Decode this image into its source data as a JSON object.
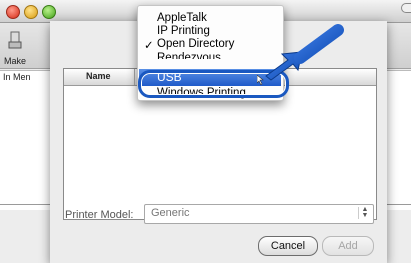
{
  "background_window": {
    "toolbar_item_label": "Make",
    "sidebar_label": "In Men"
  },
  "sheet": {
    "list_column_name": "Name",
    "printer_model_label": "Printer Model:",
    "printer_model_value": "Generic",
    "cancel_label": "Cancel",
    "add_label": "Add"
  },
  "popup_menu": {
    "items": [
      {
        "label": "AppleTalk",
        "checked": false
      },
      {
        "label": "IP Printing",
        "checked": false
      },
      {
        "label": "Open Directory",
        "checked": true
      },
      {
        "label": "Rendezvous",
        "checked": false
      },
      {
        "label": "USB",
        "checked": false,
        "highlighted": true
      },
      {
        "label": "Windows Printing",
        "checked": false
      }
    ],
    "check_glyph": "✓"
  },
  "colors": {
    "selection": "#2a66d2",
    "callout": "#1a58c0"
  }
}
